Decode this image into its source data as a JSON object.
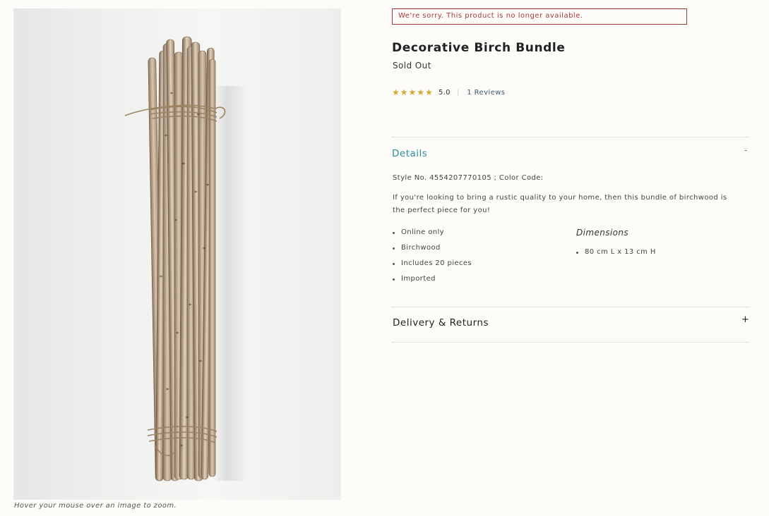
{
  "product_image": {
    "alt": "Decorative Birch Bundle",
    "zoom_hint": "Hover your mouse over an image to zoom."
  },
  "alert": {
    "text": "We're sorry. This product is no longer available.",
    "color": "#a33a3a"
  },
  "product": {
    "title": "Decorative Birch Bundle",
    "availability": "Sold Out",
    "rating": {
      "stars": 5,
      "value": "5.0",
      "reviews_label": "1 Reviews"
    }
  },
  "details": {
    "heading": "Details",
    "toggle": "-",
    "style_line": "Style No. 4554207770105 ; Color Code:",
    "description": "If you're looking to bring a rustic quality to your home, then this bundle of birchwood is the perfect piece for you!",
    "bullets": [
      "Online only",
      "Birchwood",
      "Includes 20 pieces",
      "Imported"
    ],
    "dimensions": {
      "title": "Dimensions",
      "items": [
        "80 cm L x 13 cm H"
      ]
    }
  },
  "delivery": {
    "heading": "Delivery & Returns",
    "toggle": "+"
  },
  "colors": {
    "accent": "#2c8ba0",
    "star": "#d5a92f",
    "reviews_link": "#3c5a73"
  },
  "icons": {
    "star": "star-icon",
    "expand": "plus-icon",
    "collapse": "minus-icon"
  }
}
